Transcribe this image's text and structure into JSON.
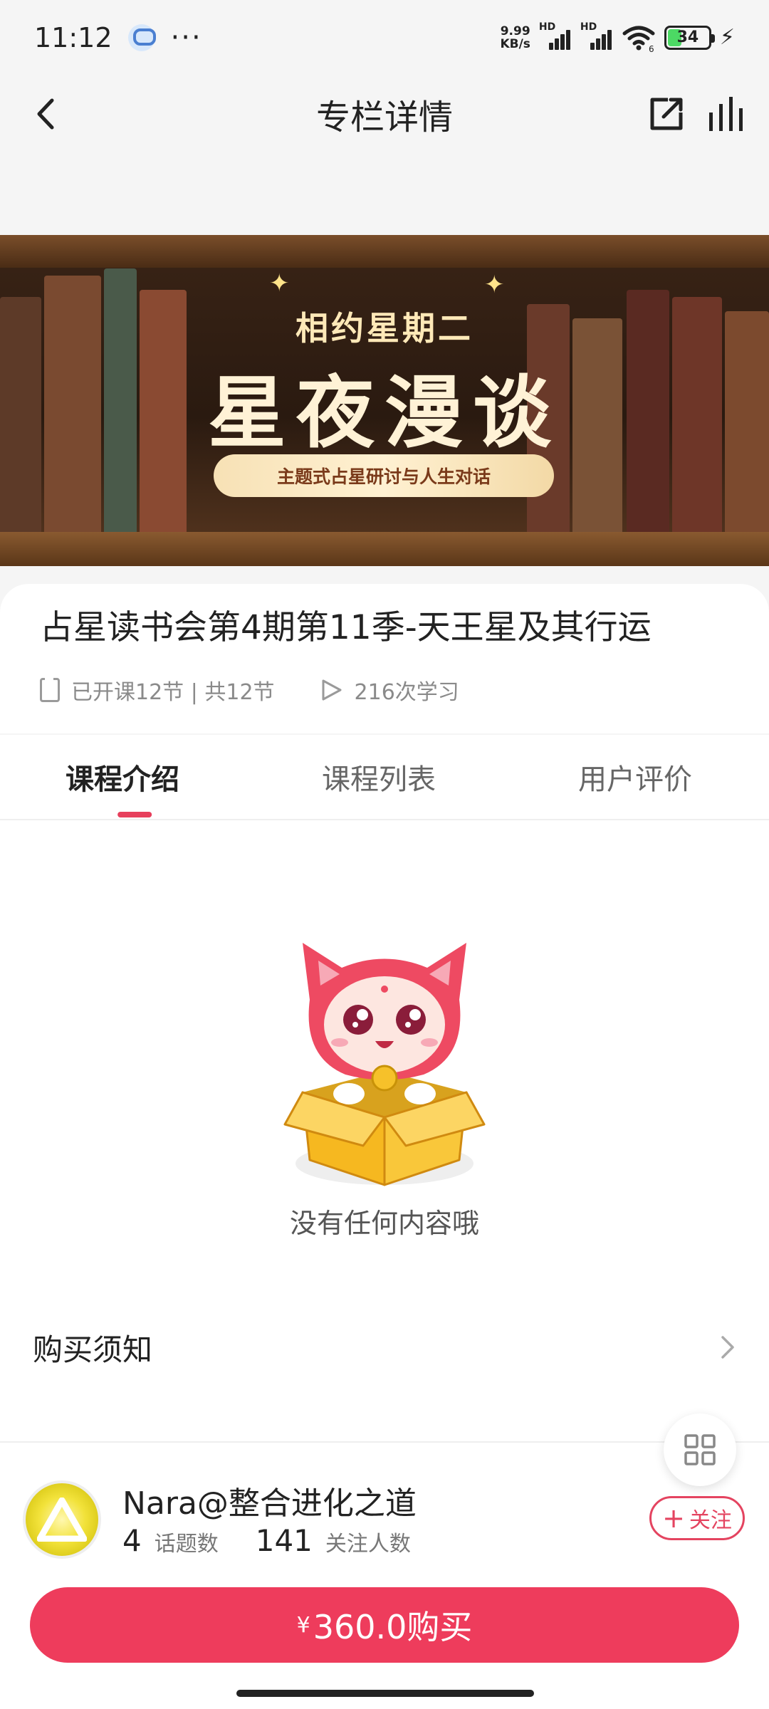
{
  "status_bar": {
    "time": "11:12",
    "more": "···",
    "speed_value": "9.99",
    "speed_unit": "KB/s",
    "hd1": "HD",
    "hd2": "HD",
    "wifi_sub": "6",
    "battery": "34",
    "battery_level": 0.34
  },
  "header": {
    "title": "专栏详情"
  },
  "banner": {
    "sub_title": "相约星期二",
    "main_title": "星夜漫谈",
    "tagline": "主题式占星研讨与人生对话"
  },
  "course": {
    "title": "占星读书会第4期第11季-天王星及其行运",
    "lessons": "已开课12节 | 共12节",
    "views": "216次学习"
  },
  "tabs": [
    {
      "label": "课程介绍",
      "active": true
    },
    {
      "label": "课程列表",
      "active": false
    },
    {
      "label": "用户评价",
      "active": false
    }
  ],
  "content": {
    "empty_text": "没有任何内容哦",
    "purchase_notice": "购买须知"
  },
  "author": {
    "name": "Nara@整合进化之道",
    "topics_count": "4",
    "topics_label": "话题数",
    "followers_count": "141",
    "followers_label": "关注人数",
    "follow_label": "关注",
    "follow_plus": "+"
  },
  "buy": {
    "currency": "¥",
    "label": "360.0购买"
  },
  "colors": {
    "accent": "#ee3c5c",
    "tab_indicator": "#e73f5c",
    "battery_fill": "#4cd964"
  }
}
